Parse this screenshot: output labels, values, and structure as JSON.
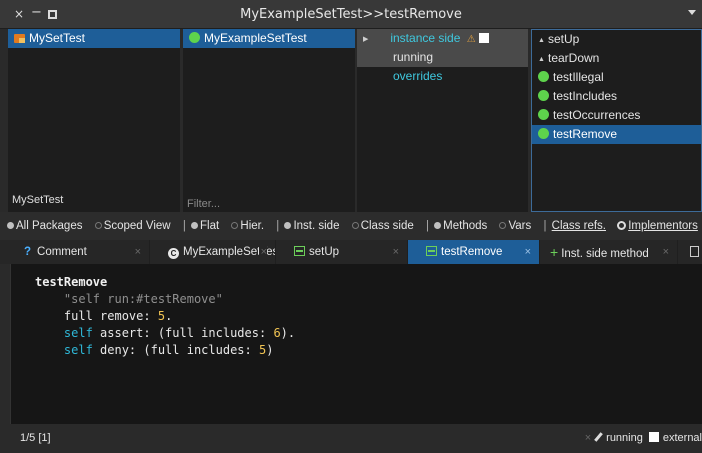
{
  "window": {
    "title": "MyExampleSetTest>>testRemove",
    "close": "×",
    "minimize": "−"
  },
  "packages": {
    "items": [
      {
        "label": "MySetTest",
        "selected": true
      }
    ],
    "footer": "MySetTest"
  },
  "classes": {
    "items": [
      {
        "label": "MyExampleSetTest",
        "selected": true
      }
    ],
    "filter_placeholder": "Filter..."
  },
  "protocols": {
    "items": [
      {
        "label": "instance side",
        "kind": "header"
      },
      {
        "label": "running",
        "kind": "selected"
      },
      {
        "label": "overrides",
        "kind": "normal"
      }
    ]
  },
  "methods": {
    "items": [
      {
        "label": "setUp",
        "icon": "up-triangle-icon"
      },
      {
        "label": "tearDown",
        "icon": "up-triangle-icon"
      },
      {
        "label": "testIllegal",
        "icon": "green-dot-icon"
      },
      {
        "label": "testIncludes",
        "icon": "green-dot-icon"
      },
      {
        "label": "testOccurrences",
        "icon": "green-dot-icon"
      },
      {
        "label": "testRemove",
        "icon": "green-dot-icon",
        "selected": true
      }
    ]
  },
  "toolbar": {
    "all_packages": "All Packages",
    "scoped_view": "Scoped View",
    "flat": "Flat",
    "hier": "Hier.",
    "inst_side": "Inst. side",
    "class_side": "Class side",
    "methods": "Methods",
    "vars": "Vars",
    "class_refs": "Class refs.",
    "implementors": "Implementors",
    "sep": "|"
  },
  "tabs": [
    {
      "label": "Comment",
      "icon": "?"
    },
    {
      "label": "MyExampleSetTest",
      "icon": "C"
    },
    {
      "label": "setUp",
      "icon": "method-icon"
    },
    {
      "label": "testRemove",
      "icon": "method-icon",
      "active": true
    },
    {
      "label": "Inst. side method",
      "icon": "+"
    }
  ],
  "editor": {
    "selector": "testRemove",
    "comment": "\"self run:#testRemove\"",
    "l2_a": "full remove: ",
    "l2_n": "5",
    "l2_b": ".",
    "l3_kw": "self",
    "l3_a": " assert: (full includes: ",
    "l3_n": "6",
    "l3_b": ").",
    "l4_kw": "self",
    "l4_a": " deny: (full includes: ",
    "l4_n": "5",
    "l4_b": ")"
  },
  "status": {
    "position": "1/5 [1]",
    "close": "×",
    "protocol": "running",
    "external": "external"
  }
}
